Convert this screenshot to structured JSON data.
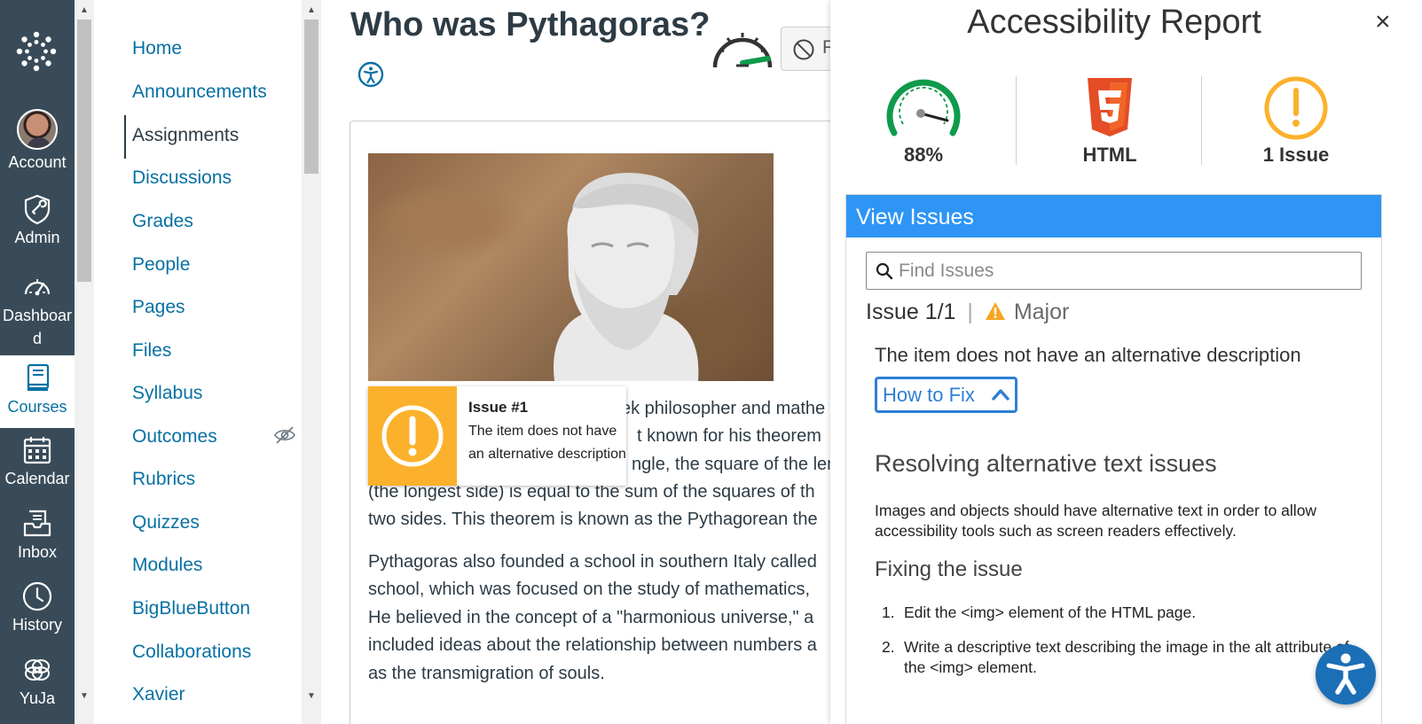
{
  "global_nav": {
    "items": [
      {
        "label": "Account",
        "icon": "avatar"
      },
      {
        "label": "Admin",
        "icon": "admin-shield-icon"
      },
      {
        "label": "Dashboard",
        "label_line1": "Dashboar",
        "label_line2": "d",
        "icon": "dashboard-gauge-icon"
      },
      {
        "label": "Courses",
        "icon": "courses-book-icon",
        "active": true
      },
      {
        "label": "Calendar",
        "icon": "calendar-icon"
      },
      {
        "label": "Inbox",
        "icon": "inbox-icon"
      },
      {
        "label": "History",
        "icon": "history-clock-icon"
      },
      {
        "label": "YuJa",
        "icon": "yuja-icon"
      }
    ]
  },
  "course_nav": {
    "items": [
      {
        "label": "Home"
      },
      {
        "label": "Announcements"
      },
      {
        "label": "Assignments",
        "active": true
      },
      {
        "label": "Discussions"
      },
      {
        "label": "Grades"
      },
      {
        "label": "People"
      },
      {
        "label": "Pages"
      },
      {
        "label": "Files"
      },
      {
        "label": "Syllabus"
      },
      {
        "label": "Outcomes",
        "hidden": true
      },
      {
        "label": "Rubrics"
      },
      {
        "label": "Quizzes"
      },
      {
        "label": "Modules"
      },
      {
        "label": "BigBlueButton"
      },
      {
        "label": "Collaborations"
      },
      {
        "label": "Xavier"
      }
    ]
  },
  "content": {
    "title": "Who was Pythagoras?",
    "flag_button_label": "F",
    "issue_tooltip": {
      "title": "Issue #1",
      "text": "The item does not have an alternative description"
    },
    "paragraph1_lines": [
      "ek philosopher and mathe",
      "t known for his theorem",
      "ngle, the square of the len",
      "(the longest side) is equal to the sum of the squares of th",
      "two sides. This theorem is known as the Pythagorean the"
    ],
    "paragraph2_lines": [
      "Pythagoras also founded a school in southern Italy called",
      "school, which was focused on the study of mathematics,",
      "He believed in the concept of a \"harmonious universe,\" a",
      "included ideas about the relationship between numbers a",
      "as the transmigration of souls."
    ]
  },
  "report": {
    "title": "Accessibility Report",
    "close_symbol": "×",
    "score": {
      "value": 88,
      "label": "88%"
    },
    "format_label": "HTML",
    "issues_label": "1 Issue",
    "view_issues": "View Issues",
    "search_placeholder": "Find Issues",
    "issue_count": "Issue 1/1",
    "separator": "|",
    "severity": "Major",
    "issue_description": "The item does not have an alternative description",
    "how_to_fix": "How to Fix",
    "resolve_heading": "Resolving alternative text issues",
    "resolve_text": "Images and objects should have alternative text in order to allow accessibility tools such as screen readers effectively.",
    "fix_heading": "Fixing the issue",
    "fix_steps": [
      "Edit the <img> element of the HTML page.",
      "Write a descriptive text describing the image in the alt attribute of the <img> element."
    ]
  },
  "colors": {
    "nav_bg": "#394b58",
    "link": "#0770a3",
    "accent_blue": "#2e95f5",
    "warning_yellow": "#fbb12b",
    "gauge_green": "#0f9b4c",
    "html5_orange": "#e44d26"
  }
}
